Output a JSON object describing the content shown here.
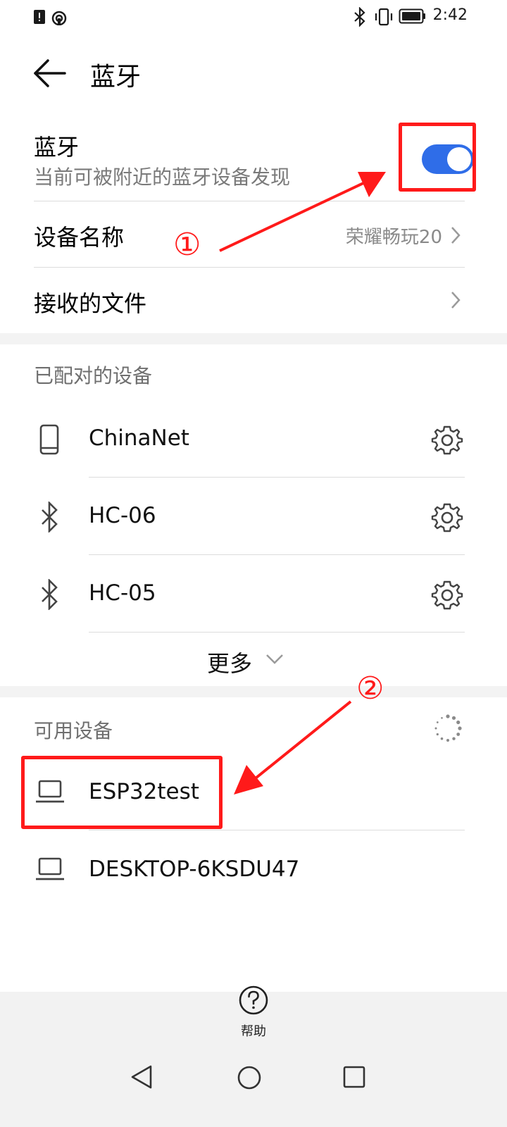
{
  "status_bar": {
    "time": "2:42"
  },
  "header": {
    "title": "蓝牙"
  },
  "bluetooth": {
    "title": "蓝牙",
    "subtitle": "当前可被附近的蓝牙设备发现",
    "enabled": true
  },
  "device_name": {
    "label": "设备名称",
    "value": "荣耀畅玩20"
  },
  "received_files": {
    "label": "接收的文件"
  },
  "paired": {
    "header": "已配对的设备",
    "devices": [
      {
        "name": "ChinaNet",
        "icon": "phone-icon"
      },
      {
        "name": "HC-06",
        "icon": "bluetooth-icon"
      },
      {
        "name": "HC-05",
        "icon": "bluetooth-icon"
      }
    ],
    "more_label": "更多"
  },
  "available": {
    "header": "可用设备",
    "devices": [
      {
        "name": "ESP32test",
        "icon": "laptop-icon"
      },
      {
        "name": "DESKTOP-6KSDU47",
        "icon": "laptop-icon"
      }
    ]
  },
  "annotations": {
    "one": "①",
    "two": "②",
    "color": "#ff1a1a"
  },
  "bottom": {
    "help_label": "帮助"
  },
  "colors": {
    "accent": "#2f6de8",
    "section_gap": "#f3f3f3",
    "bottom_bar": "#f2f2f2"
  }
}
